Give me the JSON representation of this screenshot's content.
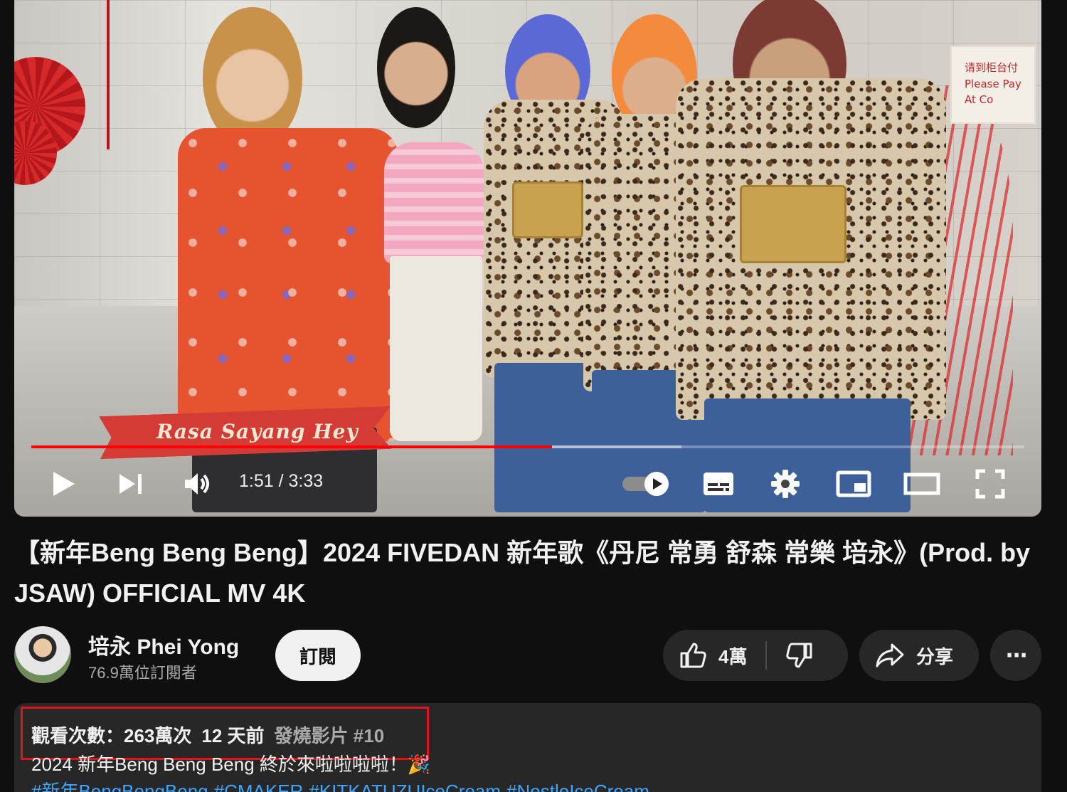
{
  "player": {
    "lyric": "Rasa Sayang Hey",
    "sign_text": "请到柜台付 Please Pay At Co",
    "time_current": "1:51",
    "time_separator": " / ",
    "time_total": "3:33",
    "progress_played": 0.524,
    "progress_buffered": 0.655,
    "accent_color": "#ff0000"
  },
  "video": {
    "title": "【新年Beng Beng Beng】2024 FIVEDAN 新年歌《丹尼 常勇 舒森 常樂 培永》(Prod. by JSAW) OFFICIAL MV 4K"
  },
  "channel": {
    "name": "培永 Phei Yong",
    "subscribers": "76.9萬位訂閱者",
    "subscribe_label": "訂閱"
  },
  "actions": {
    "like_count": "4萬",
    "share_label": "分享",
    "more_label": "⋯"
  },
  "description": {
    "views": "觀看次數：263萬次",
    "age": "12 天前",
    "trending": "發燒影片 #10",
    "line1": "2024 新年Beng Beng Beng 終於來啦啦啦啦！🎉",
    "tags": [
      "#新年BengBengBeng",
      "#CMAKER",
      "#KITKATUZUIceCream",
      "#NestleIceCream"
    ]
  },
  "icons": {
    "play": "play-icon",
    "next": "next-icon",
    "volume": "volume-icon",
    "autoplay": "autoplay-toggle-icon",
    "subtitles": "subtitles-icon",
    "settings": "gear-icon",
    "miniplayer": "miniplayer-icon",
    "theater": "theater-mode-icon",
    "fullscreen": "fullscreen-icon",
    "like": "thumbs-up-icon",
    "dislike": "thumbs-down-icon",
    "share": "share-icon",
    "more": "more-icon"
  }
}
